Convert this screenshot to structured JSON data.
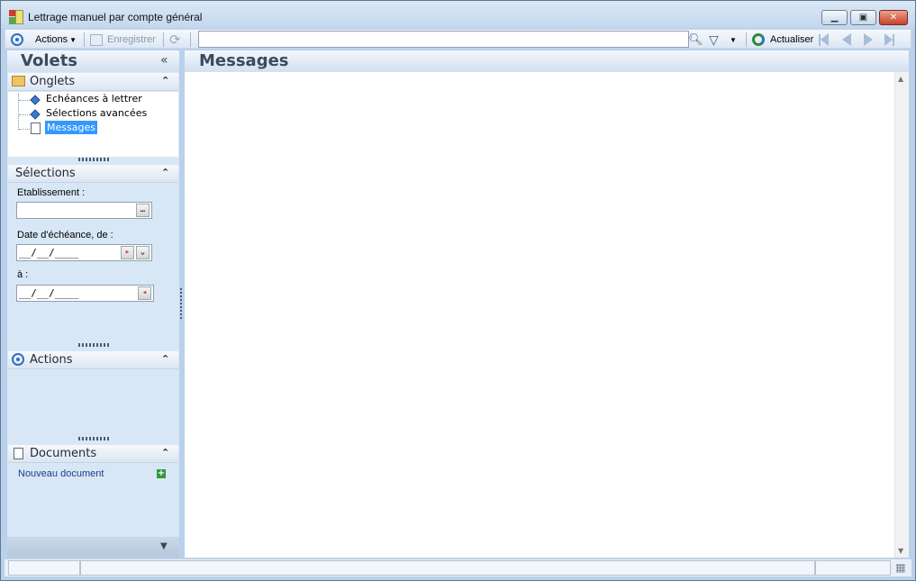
{
  "window": {
    "title": "Lettrage manuel par compte général",
    "buttons": [
      "minimize",
      "restore",
      "close"
    ]
  },
  "toolbar": {
    "actions_label": "Actions",
    "save_label": "Enregistrer",
    "search_value": "",
    "refresh_label": "Actualiser"
  },
  "left_panel": {
    "title": "Volets",
    "collapse_glyph": "«",
    "onglets": {
      "header": "Onglets",
      "items": [
        {
          "label": "Echéances à lettrer",
          "icon": "diamond-icon"
        },
        {
          "label": "Sélections avancées",
          "icon": "diamond-icon"
        },
        {
          "label": "Messages",
          "icon": "document-icon",
          "selected": true
        }
      ]
    },
    "selections": {
      "header": "Sélections",
      "etablissement_label": "Etablissement :",
      "etablissement_value": "",
      "date_label": "Date d'échéance, de :",
      "date_from_value": "__/__/____",
      "date_to_label": "à :",
      "date_to_value": "__/__/____"
    },
    "actions": {
      "header": "Actions"
    },
    "documents": {
      "header": "Documents",
      "new_document_label": "Nouveau document"
    }
  },
  "main": {
    "title": "Messages"
  },
  "colors": {
    "window_bg": "#b9d1ea",
    "panel_bg": "#d8e7f6",
    "header_text": "#3b4a5c",
    "selection": "#3399ff",
    "link": "#1a3e8c"
  }
}
